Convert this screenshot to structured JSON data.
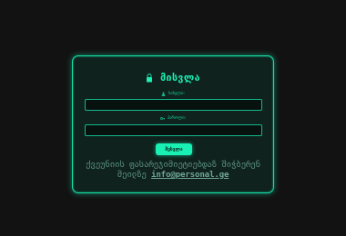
{
  "login": {
    "title": "მისვლა",
    "username_label": "სახელი:",
    "password_label": "პაროლი:",
    "username_value": "",
    "password_value": "",
    "submit_label": "შესვლა",
    "footer_text": "ქვეუნიის ფასარეჯიმიეტიებდაზ შიჭბერენ",
    "footer_text_2": "მეილზე",
    "footer_email": "info@personal.ge"
  },
  "icons": {
    "title": "lock-icon",
    "username": "user-icon",
    "password": "key-icon"
  },
  "colors": {
    "background": "#121212",
    "card": "#0f221d",
    "accent": "#19f0b4",
    "footer": "#5b8f80"
  }
}
